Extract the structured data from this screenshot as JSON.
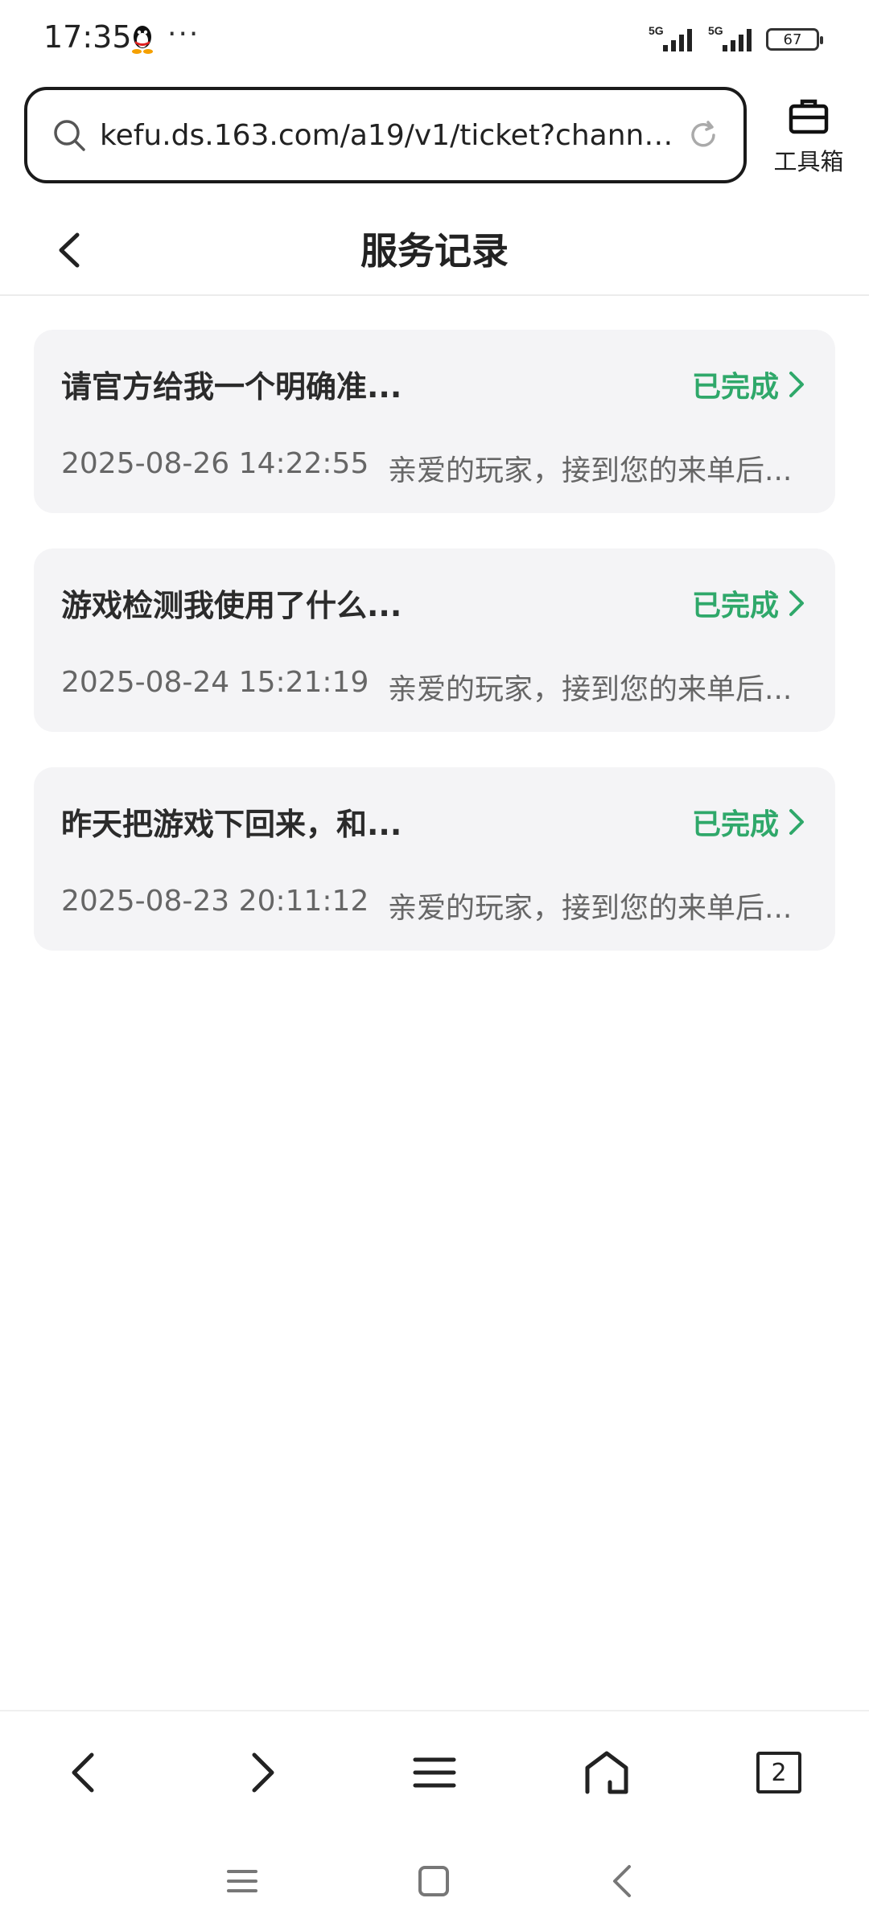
{
  "status_bar": {
    "time": "17:35",
    "more": "···",
    "signal_1_label": "5G",
    "signal_2_label": "5G",
    "battery": "67"
  },
  "url_bar": {
    "url": "kefu.ds.163.com/a19/v1/ticket?channel…",
    "toolbox_label": "工具箱"
  },
  "header": {
    "title": "服务记录"
  },
  "records": [
    {
      "title": "请官方给我一个明确准...",
      "status": "已完成",
      "date": "2025-08-26 14:22:55",
      "summary": "亲爱的玩家，接到您的来单后..."
    },
    {
      "title": "游戏检测我使用了什么...",
      "status": "已完成",
      "date": "2025-08-24 15:21:19",
      "summary": "亲爱的玩家，接到您的来单后..."
    },
    {
      "title": "昨天把游戏下回来，和...",
      "status": "已完成",
      "date": "2025-08-23 20:11:12",
      "summary": "亲爱的玩家，接到您的来单后..."
    }
  ],
  "browser_toolbar": {
    "tab_count": "2"
  },
  "colors": {
    "status_green": "#2fa86a",
    "card_bg": "#f4f4f6"
  }
}
